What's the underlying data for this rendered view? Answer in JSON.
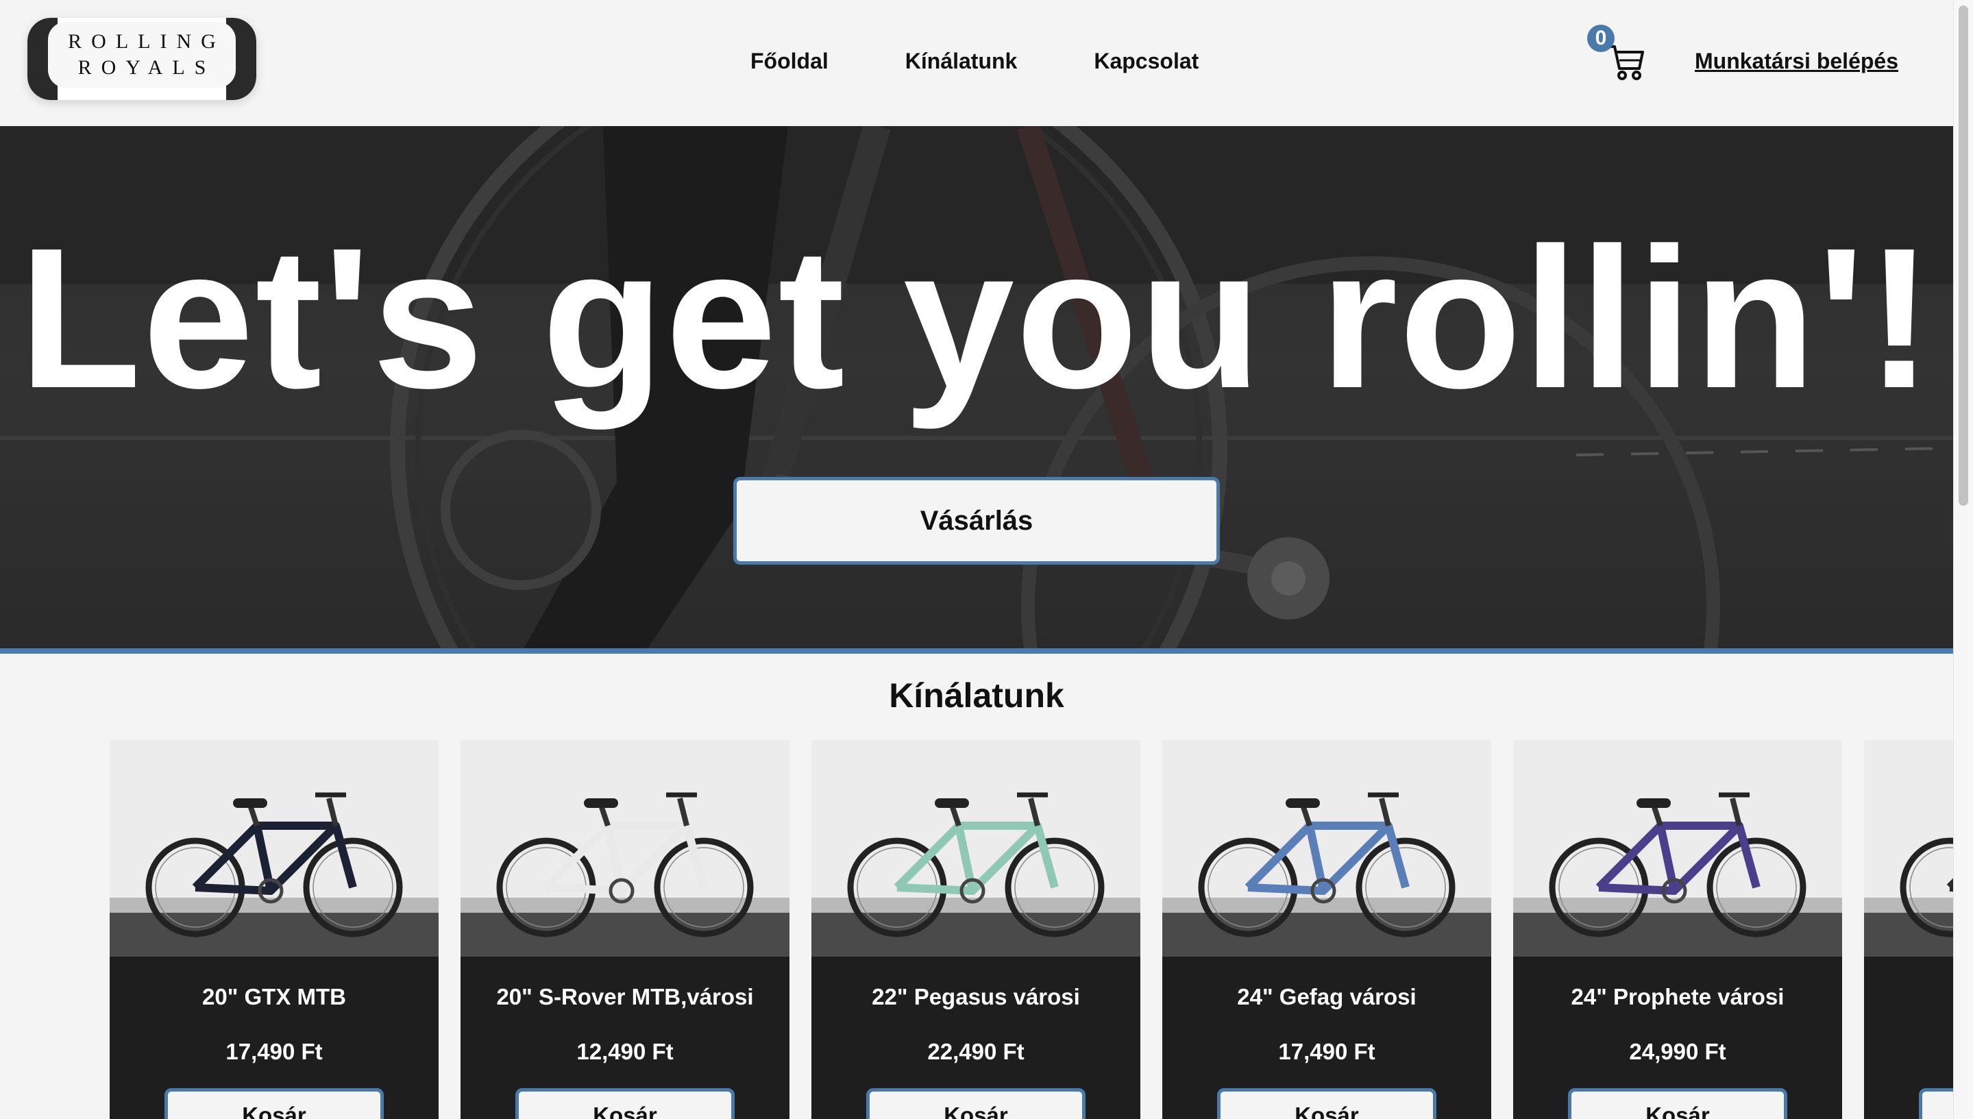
{
  "brand": {
    "logo_line1": "ROLLING",
    "logo_line2": "ROYALS"
  },
  "nav": {
    "links": [
      "Főoldal",
      "Kínálatunk",
      "Kapcsolat"
    ],
    "cart_count": "0",
    "staff_login": "Munkatársi belépés"
  },
  "hero": {
    "title": "Let's get you rollin'!",
    "cta_label": "Vásárlás"
  },
  "offers": {
    "title": "Kínálatunk",
    "button_label": "Kosár",
    "products": [
      {
        "name": "20\" GTX MTB",
        "price": "17,490 Ft",
        "frame_color": "#1c2233"
      },
      {
        "name": "20\" S-Rover MTB,városi",
        "price": "12,490 Ft",
        "frame_color": "#e9e9e9"
      },
      {
        "name": "22\" Pegasus városi",
        "price": "22,490 Ft",
        "frame_color": "#8fc9b6"
      },
      {
        "name": "24\" Gefag városi",
        "price": "17,490 Ft",
        "frame_color": "#5a7fb8"
      },
      {
        "name": "24\" Prophete városi",
        "price": "24,990 Ft",
        "frame_color": "#4b3f8c"
      }
    ]
  },
  "colors": {
    "accent": "#4a7aab",
    "card_bg": "#1e1e1e",
    "page_bg": "#f4f4f4"
  }
}
